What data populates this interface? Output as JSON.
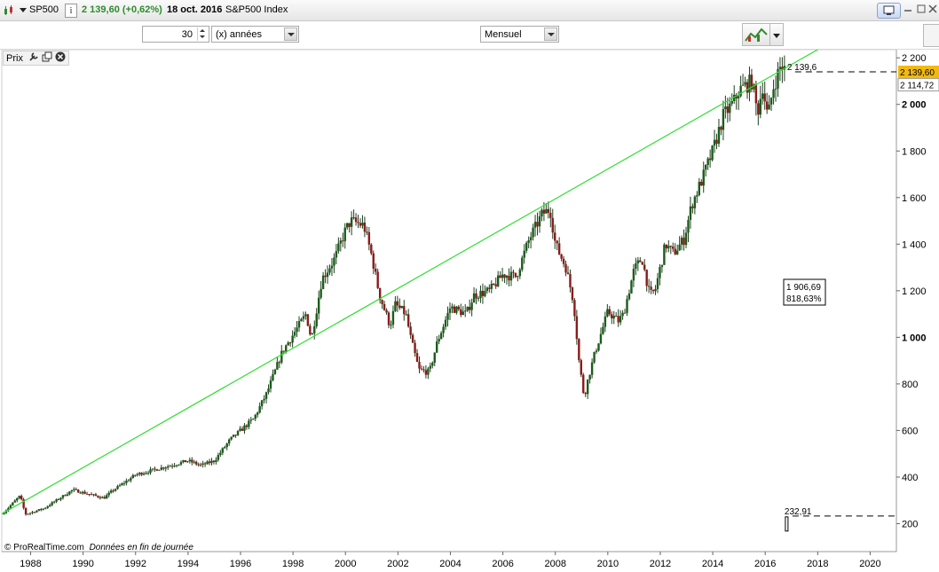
{
  "header": {
    "symbol": "SP500",
    "price_change": "2 139,60 (+0,62%)",
    "date": "18 oct. 2016",
    "index_name": "S&P500 Index",
    "price_color": "#2e8b2e"
  },
  "toolbar": {
    "period_value": "30",
    "period_unit": "(x) années",
    "timeframe": "Mensuel"
  },
  "panel": {
    "label": "Prix"
  },
  "footer": {
    "copyright": "© ProRealTime.com",
    "note": "Données en fin de journée"
  },
  "chart_data": {
    "type": "candlestick",
    "symbol": "SP500",
    "timeframe": "Mensuel",
    "x_ticks": [
      "1988",
      "1990",
      "1992",
      "1994",
      "1996",
      "1998",
      "2000",
      "2002",
      "2004",
      "2006",
      "2008",
      "2010",
      "2012",
      "2014",
      "2016",
      "2018",
      "2020"
    ],
    "y_ticks": [
      200,
      400,
      600,
      800,
      1000,
      1200,
      1400,
      1600,
      1800,
      2000,
      2200
    ],
    "y_tick_labels": [
      "200",
      "400",
      "600",
      "800",
      "1 000",
      "1 200",
      "1 400",
      "1 600",
      "1 800",
      "2 000",
      "2 200"
    ],
    "xlim": [
      1986.9,
      2021.0
    ],
    "ylim": [
      80,
      2235
    ],
    "close_keypoints": [
      [
        1986.9,
        240
      ],
      [
        1987.6,
        320
      ],
      [
        1987.8,
        240
      ],
      [
        1988.5,
        265
      ],
      [
        1989.6,
        345
      ],
      [
        1990.8,
        310
      ],
      [
        1991.1,
        340
      ],
      [
        1992.0,
        410
      ],
      [
        1993.0,
        440
      ],
      [
        1994.0,
        470
      ],
      [
        1994.5,
        450
      ],
      [
        1995.0,
        470
      ],
      [
        1995.6,
        560
      ],
      [
        1996.5,
        650
      ],
      [
        1997.0,
        760
      ],
      [
        1997.6,
        940
      ],
      [
        1998.5,
        1100
      ],
      [
        1998.7,
        990
      ],
      [
        1999.1,
        1250
      ],
      [
        1999.6,
        1340
      ],
      [
        2000.0,
        1460
      ],
      [
        2000.2,
        1500
      ],
      [
        2000.7,
        1480
      ],
      [
        2001.0,
        1350
      ],
      [
        2001.3,
        1180
      ],
      [
        2001.7,
        1050
      ],
      [
        2001.9,
        1140
      ],
      [
        2002.3,
        1100
      ],
      [
        2002.5,
        990
      ],
      [
        2002.8,
        860
      ],
      [
        2003.2,
        850
      ],
      [
        2003.5,
        980
      ],
      [
        2004.0,
        1130
      ],
      [
        2004.6,
        1100
      ],
      [
        2004.9,
        1180
      ],
      [
        2005.5,
        1200
      ],
      [
        2006.0,
        1270
      ],
      [
        2006.5,
        1260
      ],
      [
        2007.0,
        1420
      ],
      [
        2007.5,
        1530
      ],
      [
        2007.8,
        1550
      ],
      [
        2008.0,
        1400
      ],
      [
        2008.4,
        1300
      ],
      [
        2008.7,
        1150
      ],
      [
        2008.9,
        900
      ],
      [
        2009.1,
        740
      ],
      [
        2009.2,
        800
      ],
      [
        2009.5,
        930
      ],
      [
        2010.0,
        1110
      ],
      [
        2010.4,
        1070
      ],
      [
        2010.6,
        1100
      ],
      [
        2011.0,
        1290
      ],
      [
        2011.3,
        1340
      ],
      [
        2011.6,
        1180
      ],
      [
        2011.8,
        1200
      ],
      [
        2012.2,
        1400
      ],
      [
        2012.5,
        1360
      ],
      [
        2012.9,
        1420
      ],
      [
        2013.2,
        1570
      ],
      [
        2013.6,
        1680
      ],
      [
        2014.0,
        1800
      ],
      [
        2014.4,
        1950
      ],
      [
        2014.8,
        2010
      ],
      [
        2015.0,
        2060
      ],
      [
        2015.5,
        2100
      ],
      [
        2015.7,
        1960
      ],
      [
        2015.9,
        2080
      ],
      [
        2016.1,
        1940
      ],
      [
        2016.3,
        2070
      ],
      [
        2016.6,
        2170
      ],
      [
        2016.8,
        2139.6
      ]
    ],
    "candle_up_color": "#1a5c1a",
    "candle_down_color": "#8b1a1a",
    "trendline": {
      "from": [
        1986.9,
        242
      ],
      "to": [
        2019.4,
        2325
      ],
      "color": "#33dd33"
    },
    "last_price_label": "2 139,60",
    "last_price_label_color": "#f2b90f",
    "secondary_price_label": "2 114,72",
    "annotations": [
      {
        "text": "2 139,6",
        "value": 2139.6,
        "x": 2016.8
      },
      {
        "text": "232,91",
        "value": 232.91,
        "x": 2016.7
      }
    ],
    "measure_box": {
      "value": "1 906,69",
      "percent": "818,63%"
    },
    "grid": false
  }
}
